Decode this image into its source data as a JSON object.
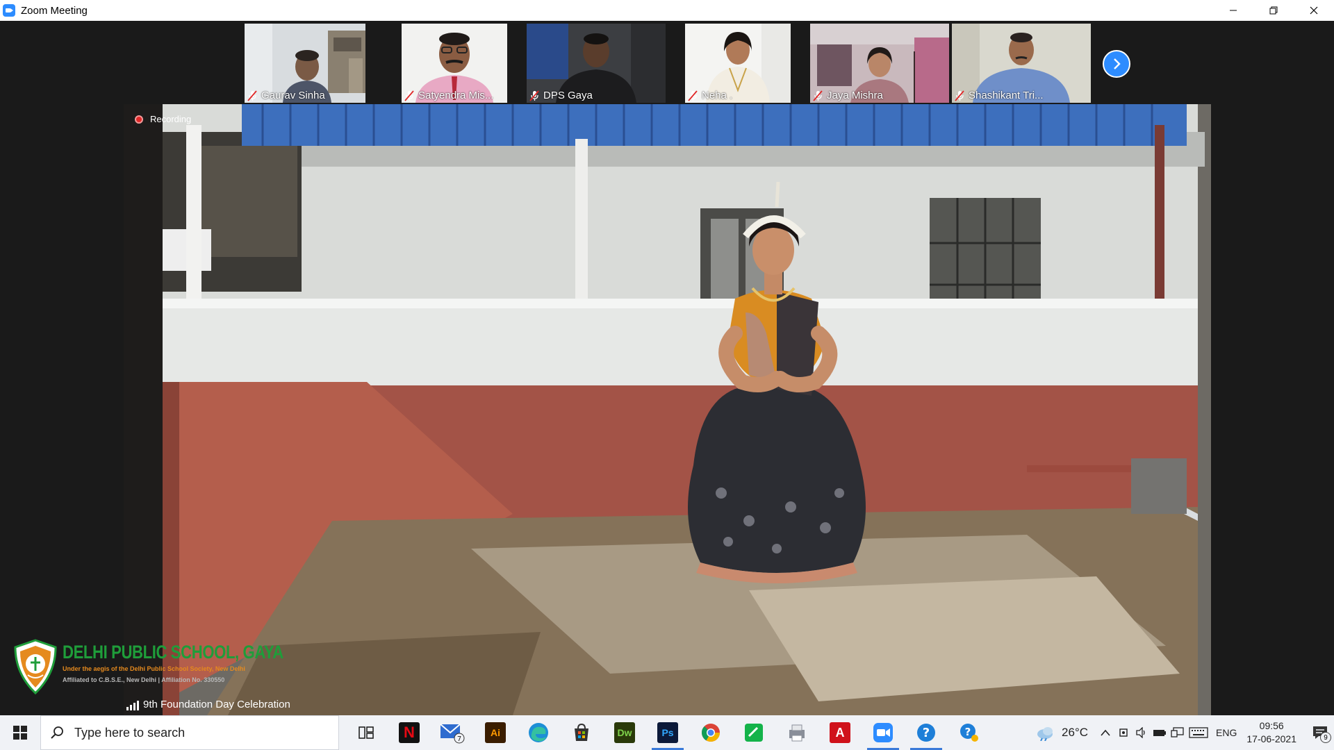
{
  "window": {
    "title": "Zoom Meeting"
  },
  "participants": [
    {
      "name": "Gaurav Sinha"
    },
    {
      "name": "Satyendra Mis..."
    },
    {
      "name": "DPS Gaya"
    },
    {
      "name": "Neha ."
    },
    {
      "name": "Jaya Mishra"
    },
    {
      "name": "Shashikant Tri..."
    }
  ],
  "recording_label": "Recording",
  "school": {
    "name": "DELHI PUBLIC SCHOOL, GAYA",
    "subtitle": "Under the aegis of the Delhi Public School Society, New Delhi",
    "affiliation": "Affiliated to C.B.S.E., New Delhi | Affiliation No. 330550"
  },
  "meeting_topic": "9th Foundation Day Celebration",
  "taskbar": {
    "search_placeholder": "Type here to search",
    "mail_badge": "7",
    "temperature": "26°C",
    "language": "ENG",
    "time": "09:56",
    "date": "17-06-2021",
    "notification_count": "9"
  },
  "colors": {
    "zoom_blue": "#2d8cff",
    "school_green": "#1f9d3a",
    "school_orange": "#e58a1e",
    "recording_red": "#e02828"
  }
}
